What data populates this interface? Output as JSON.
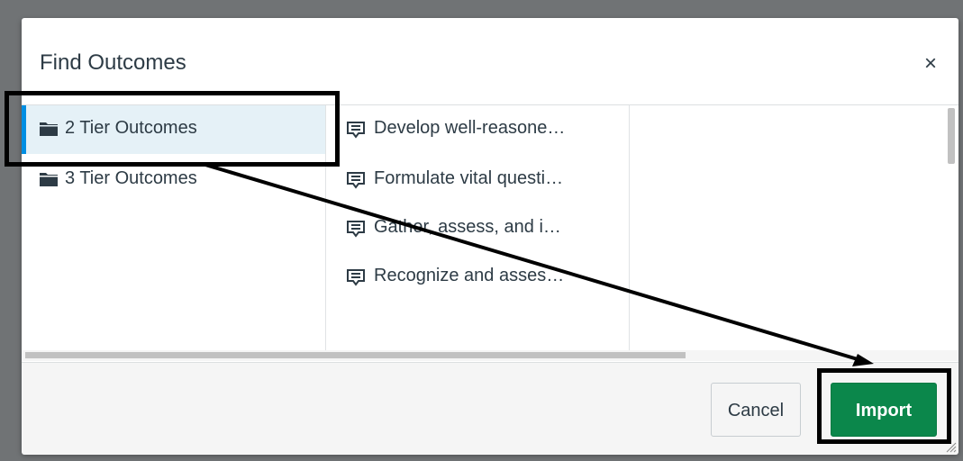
{
  "dialog": {
    "title": "Find Outcomes",
    "close_glyph": "×",
    "folders": [
      {
        "label": "2 Tier Outcomes",
        "icon": "folder-icon",
        "selected": true
      },
      {
        "label": "3 Tier Outcomes",
        "icon": "folder-icon",
        "selected": false
      }
    ],
    "outcomes": [
      {
        "label": "Develop well-reasone…",
        "icon": "outcome-icon"
      },
      {
        "label": "Formulate vital questi…",
        "icon": "outcome-icon"
      },
      {
        "label": "Gather, assess, and i…",
        "icon": "outcome-icon"
      },
      {
        "label": "Recognize and asses…",
        "icon": "outcome-icon"
      }
    ],
    "buttons": {
      "cancel": "Cancel",
      "import": "Import"
    }
  },
  "colors": {
    "import_button": "#0b874b",
    "selected_accent": "#008ee2",
    "selected_bg": "#e5f1f7"
  }
}
